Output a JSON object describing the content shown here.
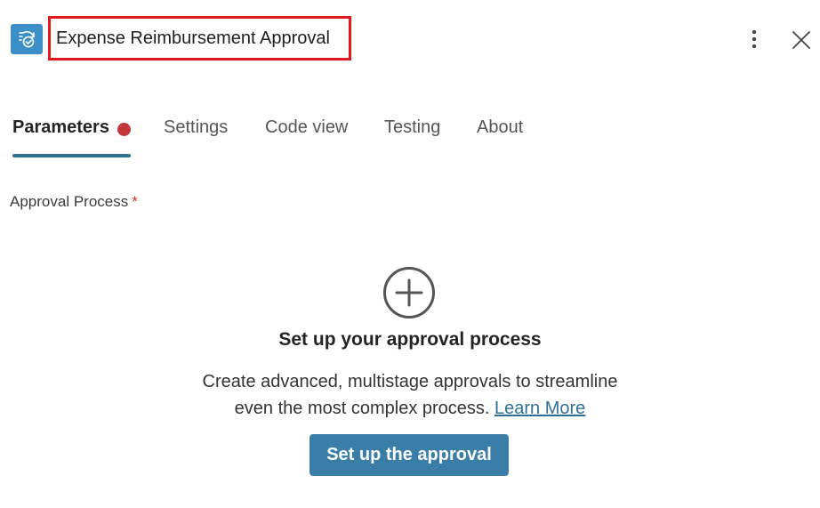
{
  "header": {
    "title": "Expense Reimbursement Approval",
    "icon": "approval-icon",
    "accent_color": "#3b8fc6",
    "highlight_color": "#e0191d"
  },
  "tabs": [
    {
      "label": "Parameters",
      "active": true,
      "has_error_dot": true
    },
    {
      "label": "Settings",
      "active": false
    },
    {
      "label": "Code view",
      "active": false
    },
    {
      "label": "Testing",
      "active": false
    },
    {
      "label": "About",
      "active": false
    }
  ],
  "field": {
    "label": "Approval Process",
    "required_mark": "*"
  },
  "empty_state": {
    "icon": "plus-circle-icon",
    "title": "Set up your approval process",
    "description_line1": "Create advanced, multistage approvals to streamline",
    "description_line2": "even the most complex process.",
    "link_label": "Learn More",
    "button_label": "Set up the approval",
    "button_color": "#3a7ea8"
  }
}
